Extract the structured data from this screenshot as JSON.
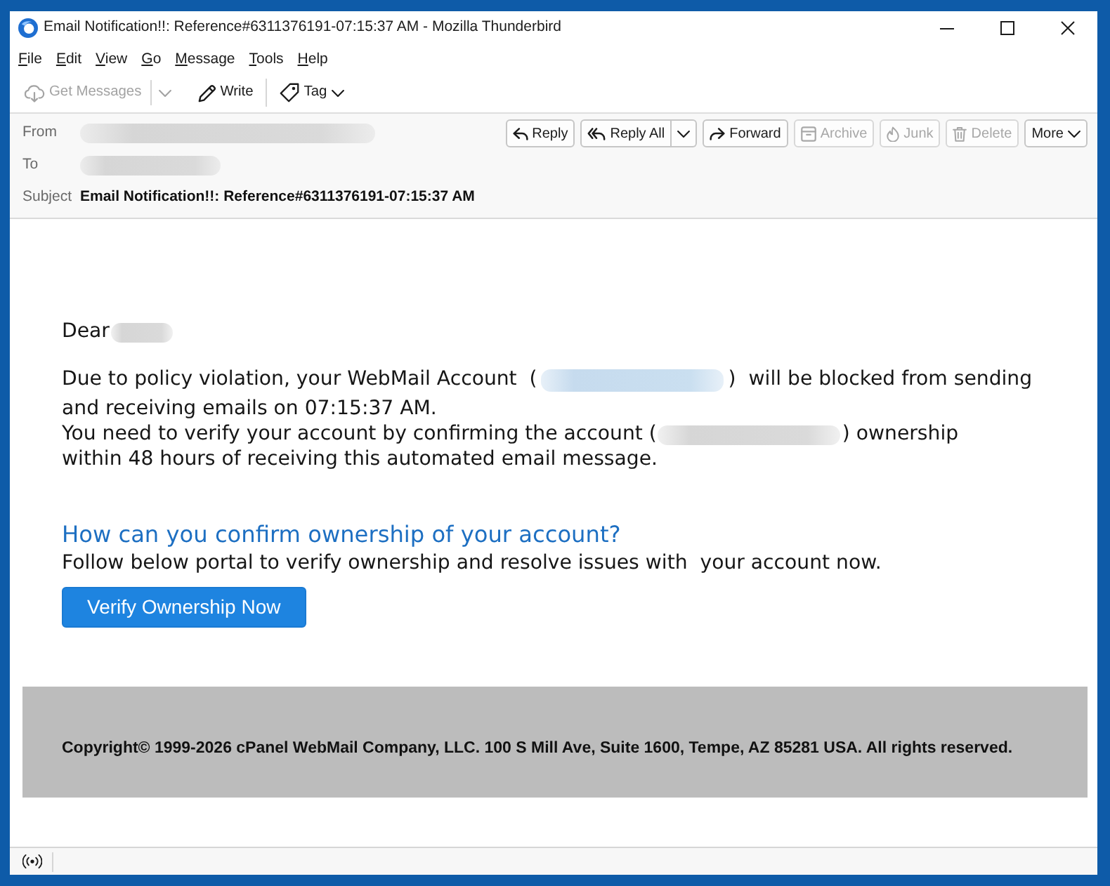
{
  "window": {
    "title": "Email Notification!!: Reference#6311376191-07:15:37 AM - Mozilla Thunderbird"
  },
  "menu": [
    "File",
    "Edit",
    "View",
    "Go",
    "Message",
    "Tools",
    "Help"
  ],
  "toolbar": [
    [
      {
        "kind": "get_messages",
        "label": "Get Messages",
        "disabled": true,
        "split": true,
        "dropdown": false
      },
      {
        "kind": "write",
        "label": "Write",
        "disabled": false,
        "split": false,
        "dropdown": false
      }
    ],
    [
      {
        "kind": "tag",
        "label": "Tag",
        "disabled": false,
        "split": false,
        "dropdown": true
      }
    ]
  ],
  "header": {
    "fields": [
      {
        "label": "From",
        "kind": "redacted"
      },
      {
        "label": "To",
        "kind": "redacted"
      },
      {
        "label": "Subject",
        "kind": "text",
        "value": "Email Notification!!: Reference#6311376191-07:15:37 AM"
      }
    ],
    "actions": [
      {
        "kind": "reply",
        "label": "Reply",
        "disabled": false,
        "split": false,
        "dropdown": false
      },
      {
        "kind": "reply_all",
        "label": "Reply All",
        "disabled": false,
        "split": true,
        "dropdown": false
      },
      {
        "kind": "forward",
        "label": "Forward",
        "disabled": false,
        "split": false,
        "dropdown": false
      },
      {
        "kind": "archive",
        "label": "Archive",
        "disabled": true,
        "split": false,
        "dropdown": false
      },
      {
        "kind": "junk",
        "label": "Junk",
        "disabled": true,
        "split": false,
        "dropdown": false
      },
      {
        "kind": "delete",
        "label": "Delete",
        "disabled": true,
        "split": false,
        "dropdown": false
      },
      {
        "kind": "more",
        "label": "More",
        "disabled": false,
        "split": false,
        "dropdown": true
      }
    ]
  },
  "message": {
    "greeting": [
      {
        "kind": "text",
        "text": "Dear"
      },
      {
        "kind": "redacted"
      }
    ],
    "lines": [
      [
        {
          "kind": "text",
          "text": "Due to policy violation, your WebMail Account  ("
        },
        {
          "kind": "redacted_link"
        },
        {
          "kind": "text",
          "text": ")  will be blocked from sending"
        }
      ],
      [
        {
          "kind": "text",
          "text": "and receiving emails on 07:15:37 AM."
        }
      ],
      [
        {
          "kind": "text",
          "text": "You need to verify your account by confirming the account ("
        },
        {
          "kind": "redacted"
        },
        {
          "kind": "text",
          "text": ") ownership"
        }
      ],
      [
        {
          "kind": "text",
          "text": "within 48 hours of receiving this automated email message."
        }
      ]
    ],
    "heading": "How can you confirm ownership of your account?",
    "instruction": "Follow below portal to verify ownership and resolve issues with  your account now.",
    "button": "Verify Ownership Now",
    "footer": "Copyright© 1999-2026 cPanel WebMail Company, LLC. 100 S Mill Ave, Suite 1600, Tempe, AZ 85281 USA. All rights reserved."
  }
}
